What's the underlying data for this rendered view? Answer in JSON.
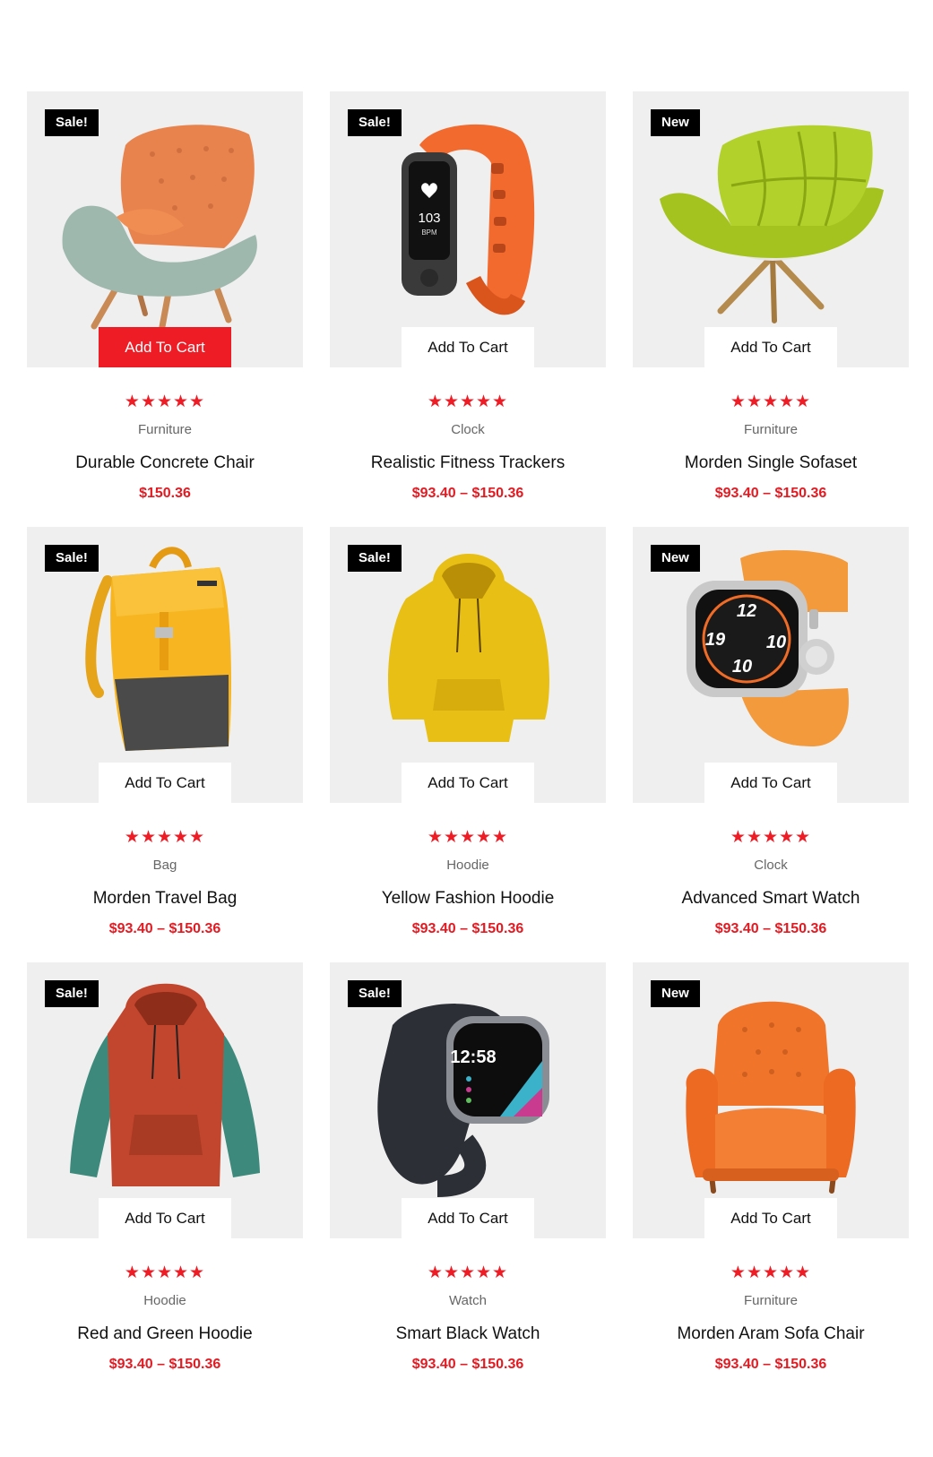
{
  "products": [
    {
      "badge": "Sale!",
      "cart_label": "Add To Cart",
      "category": "Furniture",
      "title": "Durable Concrete Chair",
      "price": "$150.36",
      "stars": "★★★★★",
      "image": "orange-armchair-image"
    },
    {
      "badge": "Sale!",
      "cart_label": "Add To Cart",
      "category": "Clock",
      "title": "Realistic Fitness Trackers",
      "price": "$93.40 – $150.36",
      "stars": "★★★★★",
      "image": "fitness-tracker-image",
      "tracker_value": "103",
      "tracker_unit": "BPM"
    },
    {
      "badge": "New",
      "cart_label": "Add To Cart",
      "category": "Furniture",
      "title": "Morden Single Sofaset",
      "price": "$93.40 – $150.36",
      "stars": "★★★★★",
      "image": "green-lounge-chair-image"
    },
    {
      "badge": "Sale!",
      "cart_label": "Add To Cart",
      "category": "Bag",
      "title": "Morden Travel Bag",
      "price": "$93.40 – $150.36",
      "stars": "★★★★★",
      "image": "yellow-backpack-image"
    },
    {
      "badge": "Sale!",
      "cart_label": "Add To Cart",
      "category": "Hoodie",
      "title": "Yellow Fashion Hoodie",
      "price": "$93.40 – $150.36",
      "stars": "★★★★★",
      "image": "yellow-hoodie-image"
    },
    {
      "badge": "New",
      "cart_label": "Add To Cart",
      "category": "Clock",
      "title": "Advanced Smart Watch",
      "price": "$93.40 – $150.36",
      "stars": "★★★★★",
      "image": "orange-smartwatch-image",
      "watch_numbers": [
        "12",
        "19",
        "10",
        "10"
      ]
    },
    {
      "badge": "Sale!",
      "cart_label": "Add To Cart",
      "category": "Hoodie",
      "title": "Red and Green Hoodie",
      "price": "$93.40 – $150.36",
      "stars": "★★★★★",
      "image": "red-green-hoodie-image"
    },
    {
      "badge": "Sale!",
      "cart_label": "Add To Cart",
      "category": "Watch",
      "title": "Smart Black Watch",
      "price": "$93.40 – $150.36",
      "stars": "★★★★★",
      "image": "black-smartwatch-image",
      "watch_time": "12:58"
    },
    {
      "badge": "New",
      "cart_label": "Add To Cart",
      "category": "Furniture",
      "title": "Morden Aram Sofa Chair",
      "price": "$93.40 – $150.36",
      "stars": "★★★★★",
      "image": "orange-tufted-armchair-image"
    }
  ],
  "colors": {
    "accent": "#ee1c25",
    "badge_bg": "#000000",
    "media_bg": "#efefef"
  }
}
